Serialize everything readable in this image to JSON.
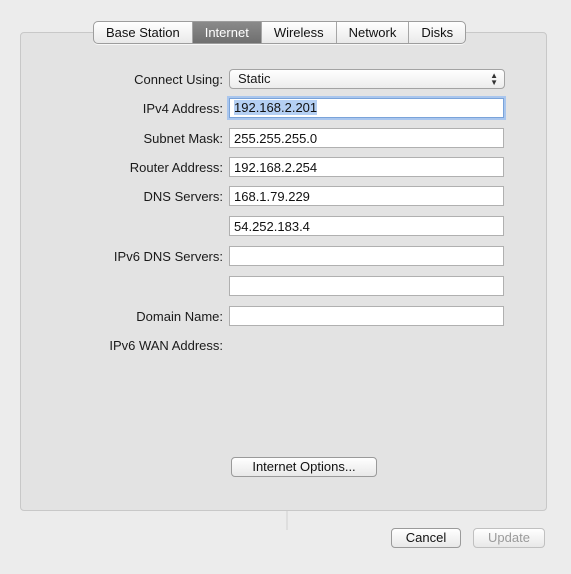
{
  "tabs": [
    {
      "label": "Base Station",
      "selected": false
    },
    {
      "label": "Internet",
      "selected": true
    },
    {
      "label": "Wireless",
      "selected": false
    },
    {
      "label": "Network",
      "selected": false
    },
    {
      "label": "Disks",
      "selected": false
    }
  ],
  "form": {
    "connect_using_label": "Connect Using:",
    "connect_using_value": "Static",
    "ipv4_label": "IPv4 Address:",
    "ipv4_value": "192.168.2.201",
    "subnet_label": "Subnet Mask:",
    "subnet_value": "255.255.255.0",
    "router_label": "Router Address:",
    "router_value": "192.168.2.254",
    "dns_label": "DNS Servers:",
    "dns1_value": "168.1.79.229",
    "dns2_value": "54.252.183.4",
    "ipv6_dns_label": "IPv6 DNS Servers:",
    "ipv6_dns1_value": "",
    "ipv6_dns2_value": "",
    "domain_label": "Domain Name:",
    "domain_value": "",
    "ipv6_wan_label": "IPv6 WAN Address:",
    "ipv6_wan_value": ""
  },
  "buttons": {
    "internet_options": "Internet Options...",
    "cancel": "Cancel",
    "update": "Update",
    "update_enabled": false
  },
  "colors": {
    "selected_tab": "#7a7a7a",
    "focus_ring": "#a9c6ee",
    "text_selection": "#b4cff3"
  }
}
